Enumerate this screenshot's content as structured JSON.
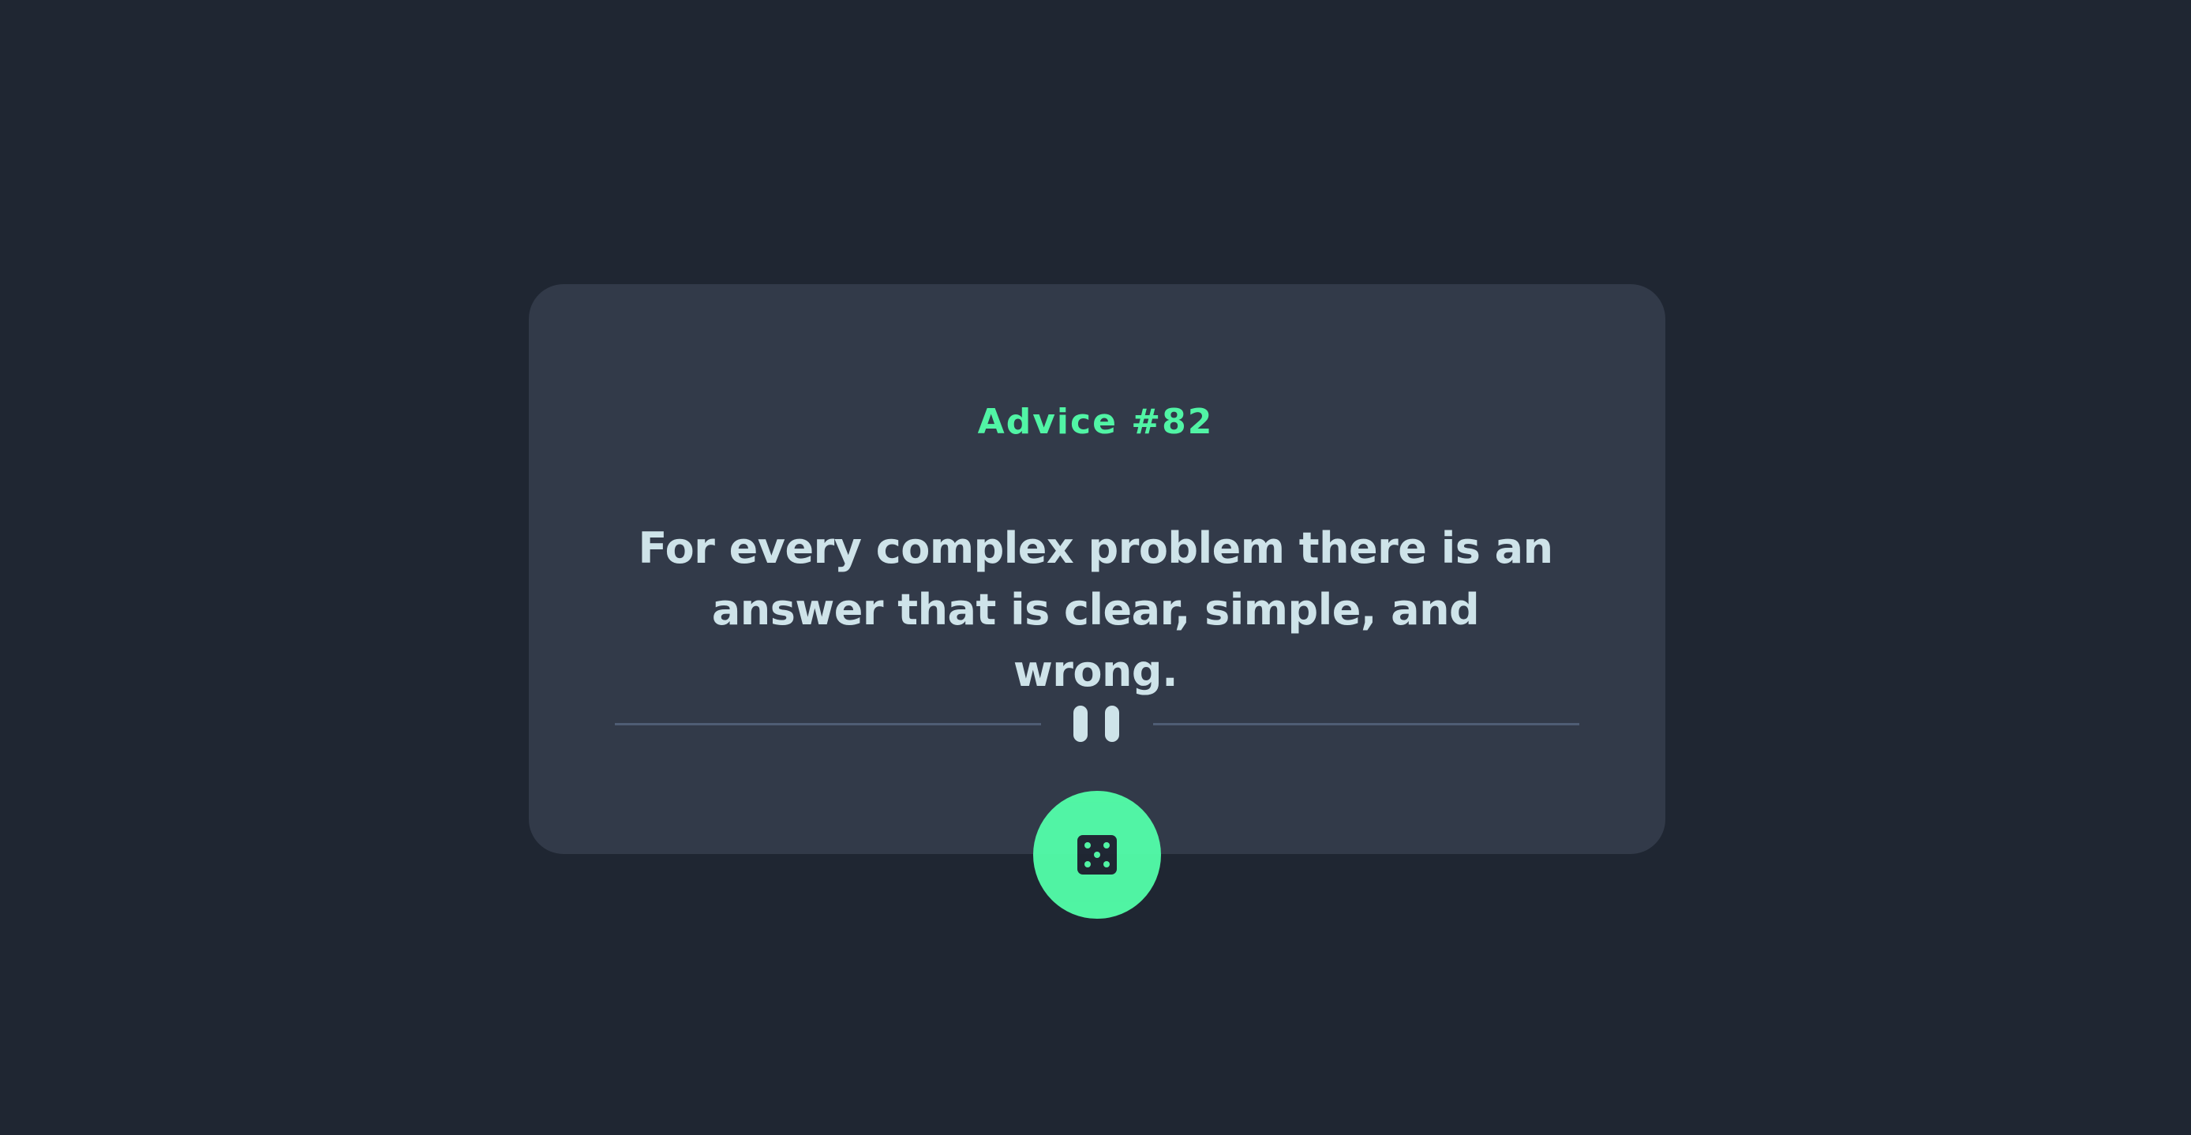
{
  "advice": {
    "title": "Advice #82",
    "quote": "For every complex problem there is an answer that is clear, simple, and wrong."
  },
  "icons": {
    "divider": "pause-icon",
    "button": "dice-icon"
  },
  "colors": {
    "background": "#1f2632",
    "card": "#323a49",
    "accent": "#53ffaa",
    "text": "#cee3e9",
    "divider": "#4f5d74"
  }
}
